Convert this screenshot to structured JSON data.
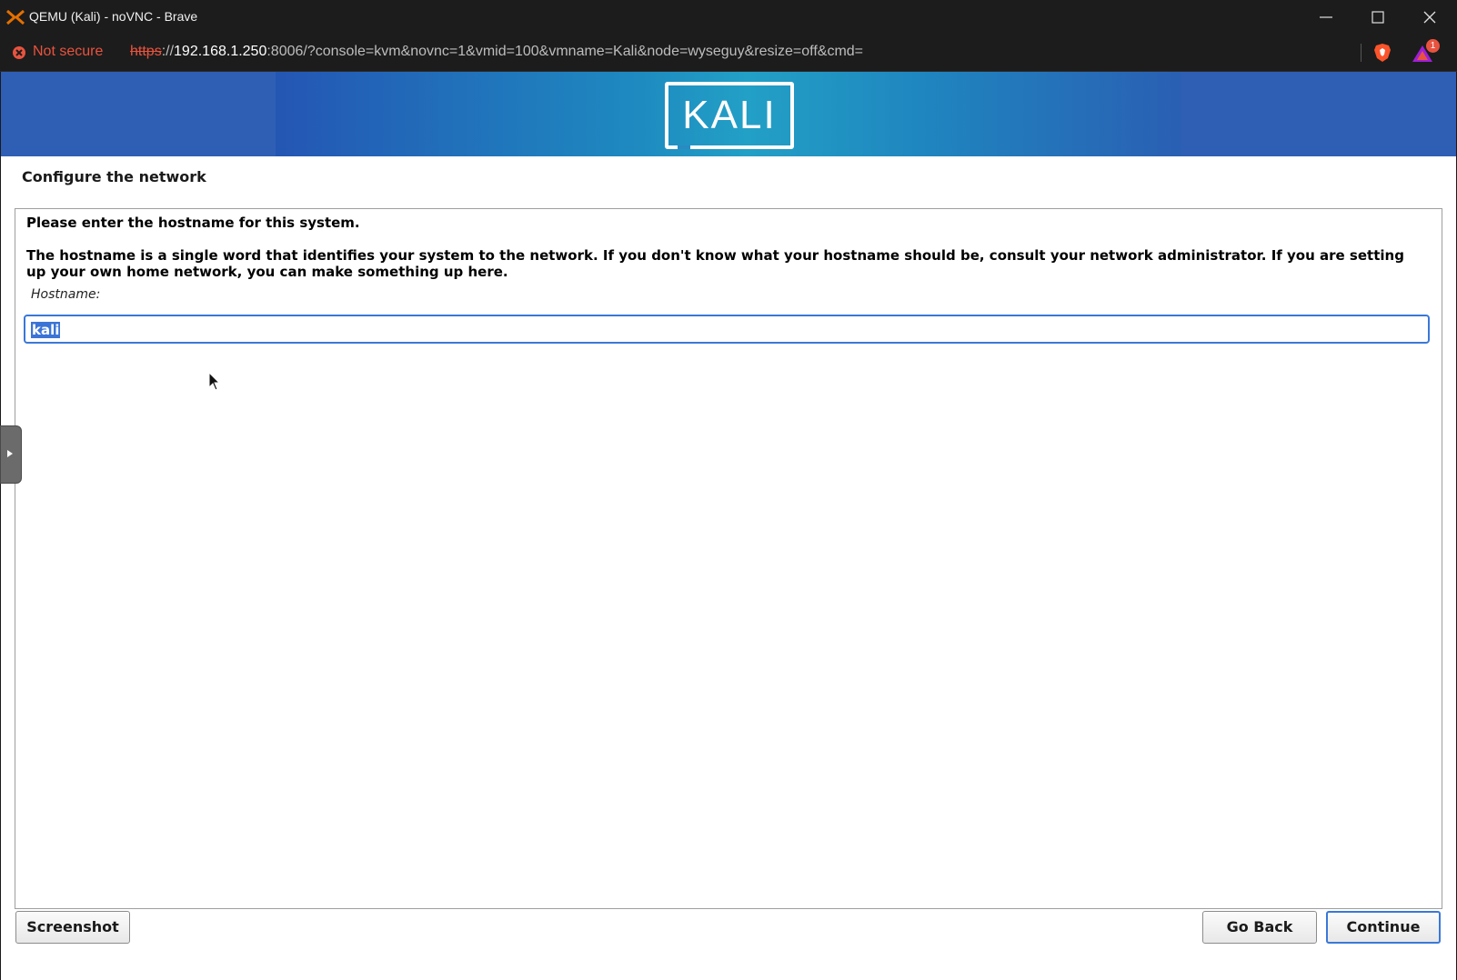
{
  "window": {
    "title": "QEMU (Kali) - noVNC - Brave",
    "minimize_icon": "minimize-icon",
    "maximize_icon": "maximize-icon",
    "close_icon": "close-icon"
  },
  "addressbar": {
    "security_label": "Not secure",
    "url_scheme": "https",
    "url_sep": "://",
    "url_host": "192.168.1.250",
    "url_rest": ":8006/?console=kvm&novnc=1&vmid=100&vmname=Kali&node=wyseguy&resize=off&cmd=",
    "rewards_count": "1"
  },
  "installer": {
    "logo_text": "KALI",
    "step_title": "Configure the network",
    "question": "Please enter the hostname for this system.",
    "description": "The hostname is a single word that identifies your system to the network. If you don't know what your hostname should be, consult your network administrator. If you are setting up your own home network, you can make something up here.",
    "field_label": "Hostname:",
    "hostname_value": "kali"
  },
  "buttons": {
    "screenshot": "Screenshot",
    "go_back": "Go Back",
    "continue": "Continue"
  },
  "colors": {
    "accent": "#3a78d8",
    "insecure": "#e8533f",
    "banner": "#2f5fb5"
  }
}
